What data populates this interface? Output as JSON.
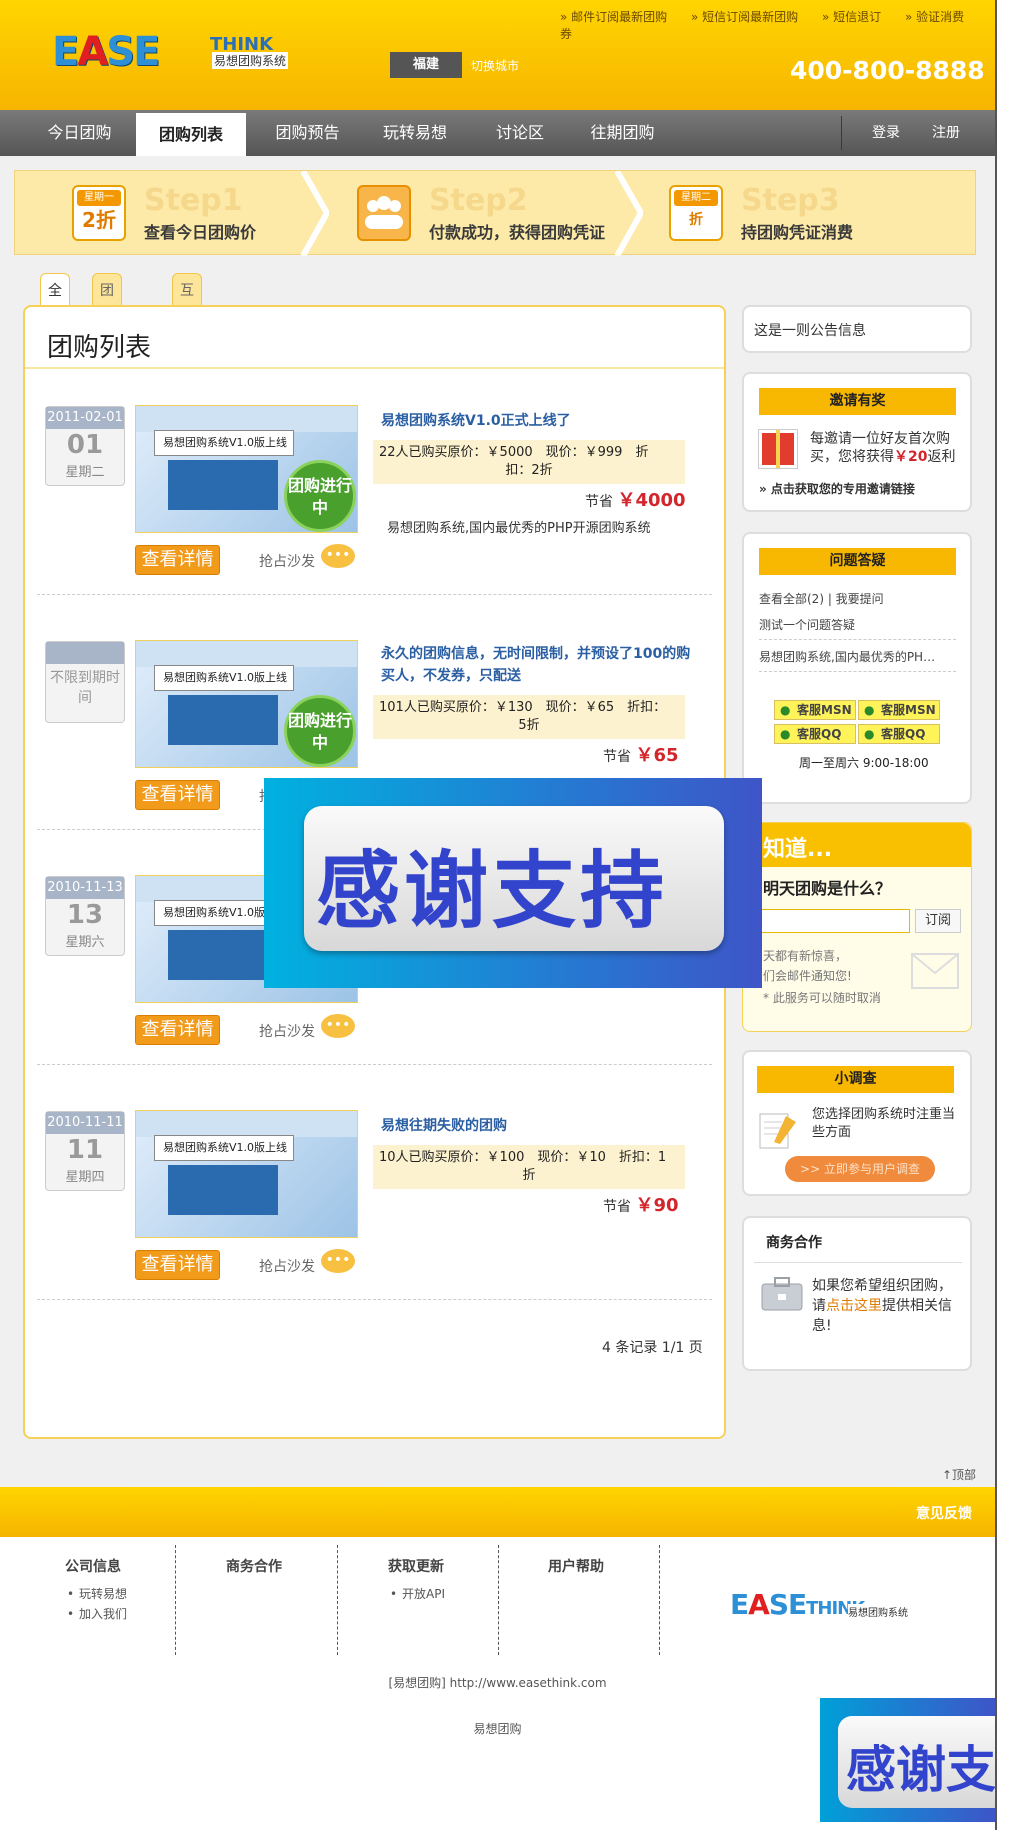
{
  "header": {
    "logo_text": "EASETHINK",
    "logo_sub": "易想团购系统",
    "top_links": [
      "邮件订阅最新团购",
      "短信订阅最新团购",
      "短信退订",
      "验证消费券"
    ],
    "city": "福建",
    "switch_city": "切换城市",
    "phone": "400-800-8888"
  },
  "nav": {
    "items": [
      "今日团购",
      "团购列表",
      "团购预告",
      "玩转易想",
      "讨论区",
      "往期团购"
    ],
    "active": "团购列表",
    "login": "登录",
    "register": "注册"
  },
  "steps": [
    {
      "tag": "星期一",
      "num": "2折",
      "title": "Step1",
      "desc": "查看今日团购价"
    },
    {
      "title": "Step2",
      "desc": "付款成功，获得团购凭证"
    },
    {
      "tag": "星期二",
      "num": "折",
      "title": "Step3",
      "desc": "持团购凭证消费"
    }
  ],
  "tabs": [
    "全部",
    "团购系统",
    "互联网"
  ],
  "main": {
    "title": "团购列表",
    "detail_button": "查看详情",
    "sofa": "抢占沙发",
    "save_label": "节省",
    "deals": [
      {
        "date_top": "2011-02-01",
        "date_day": "01",
        "date_week": "星期二",
        "title": "易想团购系统V1.0正式上线了",
        "info_line1": "22人已购买原价：￥5000　现价：￥999　折",
        "info_line2": "扣：2折",
        "save": "￥4000",
        "desc": "易想团购系统,国内最优秀的PHP开源团购系统",
        "thumb_text": "易想团购系统V1.0版上线",
        "badge": "团购进行中"
      },
      {
        "date_full": "不限到期时间",
        "title": "永久的团购信息，无时间限制，并预设了100的购买人，不发券，只配送",
        "info_line1": "101人已购买原价：￥130　现价：￥65　折扣：",
        "info_line2": "5折",
        "save": "￥65",
        "thumb_text": "易想团购系统V1.0版上线",
        "badge": "团购进行中"
      },
      {
        "date_top": "2010-11-13",
        "date_day": "13",
        "date_week": "星期六",
        "thumb_text": "易想团购系统V1.0版上线"
      },
      {
        "date_top": "2010-11-11",
        "date_day": "11",
        "date_week": "星期四",
        "title": "易想往期失败的团购",
        "info_line1": "10人已购买原价：￥100　现价：￥10　折扣：1",
        "info_line2": "折",
        "save": "￥90",
        "thumb_text": "易想团购系统V1.0版上线"
      }
    ],
    "pager": "4 条记录  1/1 页"
  },
  "sidebar": {
    "notice": "这是一则公告信息",
    "invite": {
      "title": "邀请有奖",
      "text_a": "每邀请一位好友首次购",
      "text_b": "买，您将获得",
      "amount": "￥20",
      "text_c": "返利",
      "link": "» 点击获取您的专用邀请链接"
    },
    "qa": {
      "title": "问题答疑",
      "view_all": "查看全部(2)",
      "ask": "我要提问",
      "items": [
        "测试一个问题答疑",
        "易想团购系统,国内最优秀的PH…"
      ],
      "qq": [
        "客服MSN",
        "客服MSN",
        "客服QQ",
        "客服QQ"
      ],
      "hours": "周一至周六  9:00-18:00"
    },
    "zhidao": {
      "head": "知道...",
      "question": "明天团购是什么？",
      "subscribe": "订阅",
      "t1": "天都有新惊喜，",
      "t2": "们会邮件通知您!",
      "t3": "* 此服务可以随时取消"
    },
    "survey": {
      "title": "小调查",
      "text": "您选择团购系统时注重当些方面",
      "button": ">> 立即参与用户调查"
    },
    "biz": {
      "title": "商务合作",
      "text_a": "如果您希望组织团购，请",
      "link": "点击这里",
      "text_b": "提供相关信息!"
    }
  },
  "overlay": {
    "text": "感谢支持"
  },
  "footer": {
    "to_top": "↑顶部",
    "feedback": "意见反馈",
    "cols": [
      {
        "title": "公司信息",
        "items": [
          "玩转易想",
          "加入我们"
        ]
      },
      {
        "title": "商务合作",
        "items": []
      },
      {
        "title": "获取更新",
        "items": [
          "开放API"
        ]
      },
      {
        "title": "用户帮助",
        "items": []
      }
    ],
    "site": "[易想团购] http://www.easethink.com",
    "brand": "易想团购"
  },
  "colors": {
    "brand_yellow": "#ffd500",
    "nav_gray": "#666666",
    "price_red": "#d2252c",
    "link_blue": "#2b5fa3"
  }
}
